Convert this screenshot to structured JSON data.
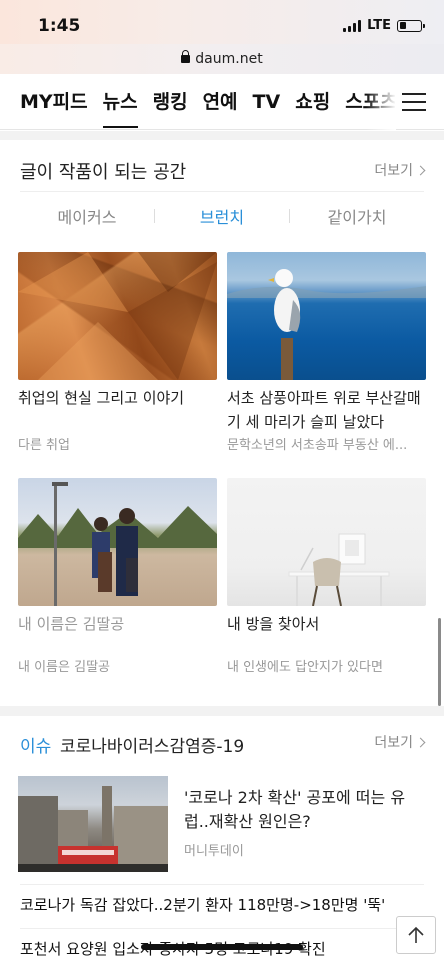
{
  "status": {
    "time": "1:45",
    "network": "LTE",
    "battery_level": 0.3
  },
  "browser": {
    "url": "daum.net"
  },
  "nav": {
    "items": [
      "MY피드",
      "뉴스",
      "랭킹",
      "연예",
      "TV",
      "쇼핑",
      "스포츠"
    ],
    "active_index": 1
  },
  "card": {
    "title": "글이 작품이 되는 공간",
    "more": "더보기",
    "tabs": [
      "메이커스",
      "브런치",
      "같이가치"
    ],
    "active_tab": 1,
    "tiles": [
      {
        "title": "취업의 현실 그리고 이야기",
        "sub": "다른 취업"
      },
      {
        "title": "서초 삼풍아파트 위로 부산갈매기 세 마리가 슬피 날았다",
        "sub": "문학소년의 서초송파 부동산 에..."
      },
      {
        "title": "내 이름은 김딸공",
        "sub": "내 이름은 김딸공"
      },
      {
        "title": "내 방을 찾아서",
        "sub": "내 인생에도 답안지가 있다면"
      }
    ]
  },
  "issue": {
    "label": "이슈",
    "title": "코로나바이러스감염증-19",
    "more": "더보기",
    "lead_title": "'코로나 2차 확산' 공포에 떠는 유럽..재확산 원인은?",
    "lead_source": "머니투데이",
    "headlines": [
      "코로나가 독감 잡았다..2분기 환자 118만명->18만명 '뚝'",
      "포천서 요양원 입소자·종사자 5명 코로나19 확진"
    ]
  },
  "colors": {
    "accent": "#2a8fd8",
    "text": "#222222",
    "muted": "#999999"
  }
}
